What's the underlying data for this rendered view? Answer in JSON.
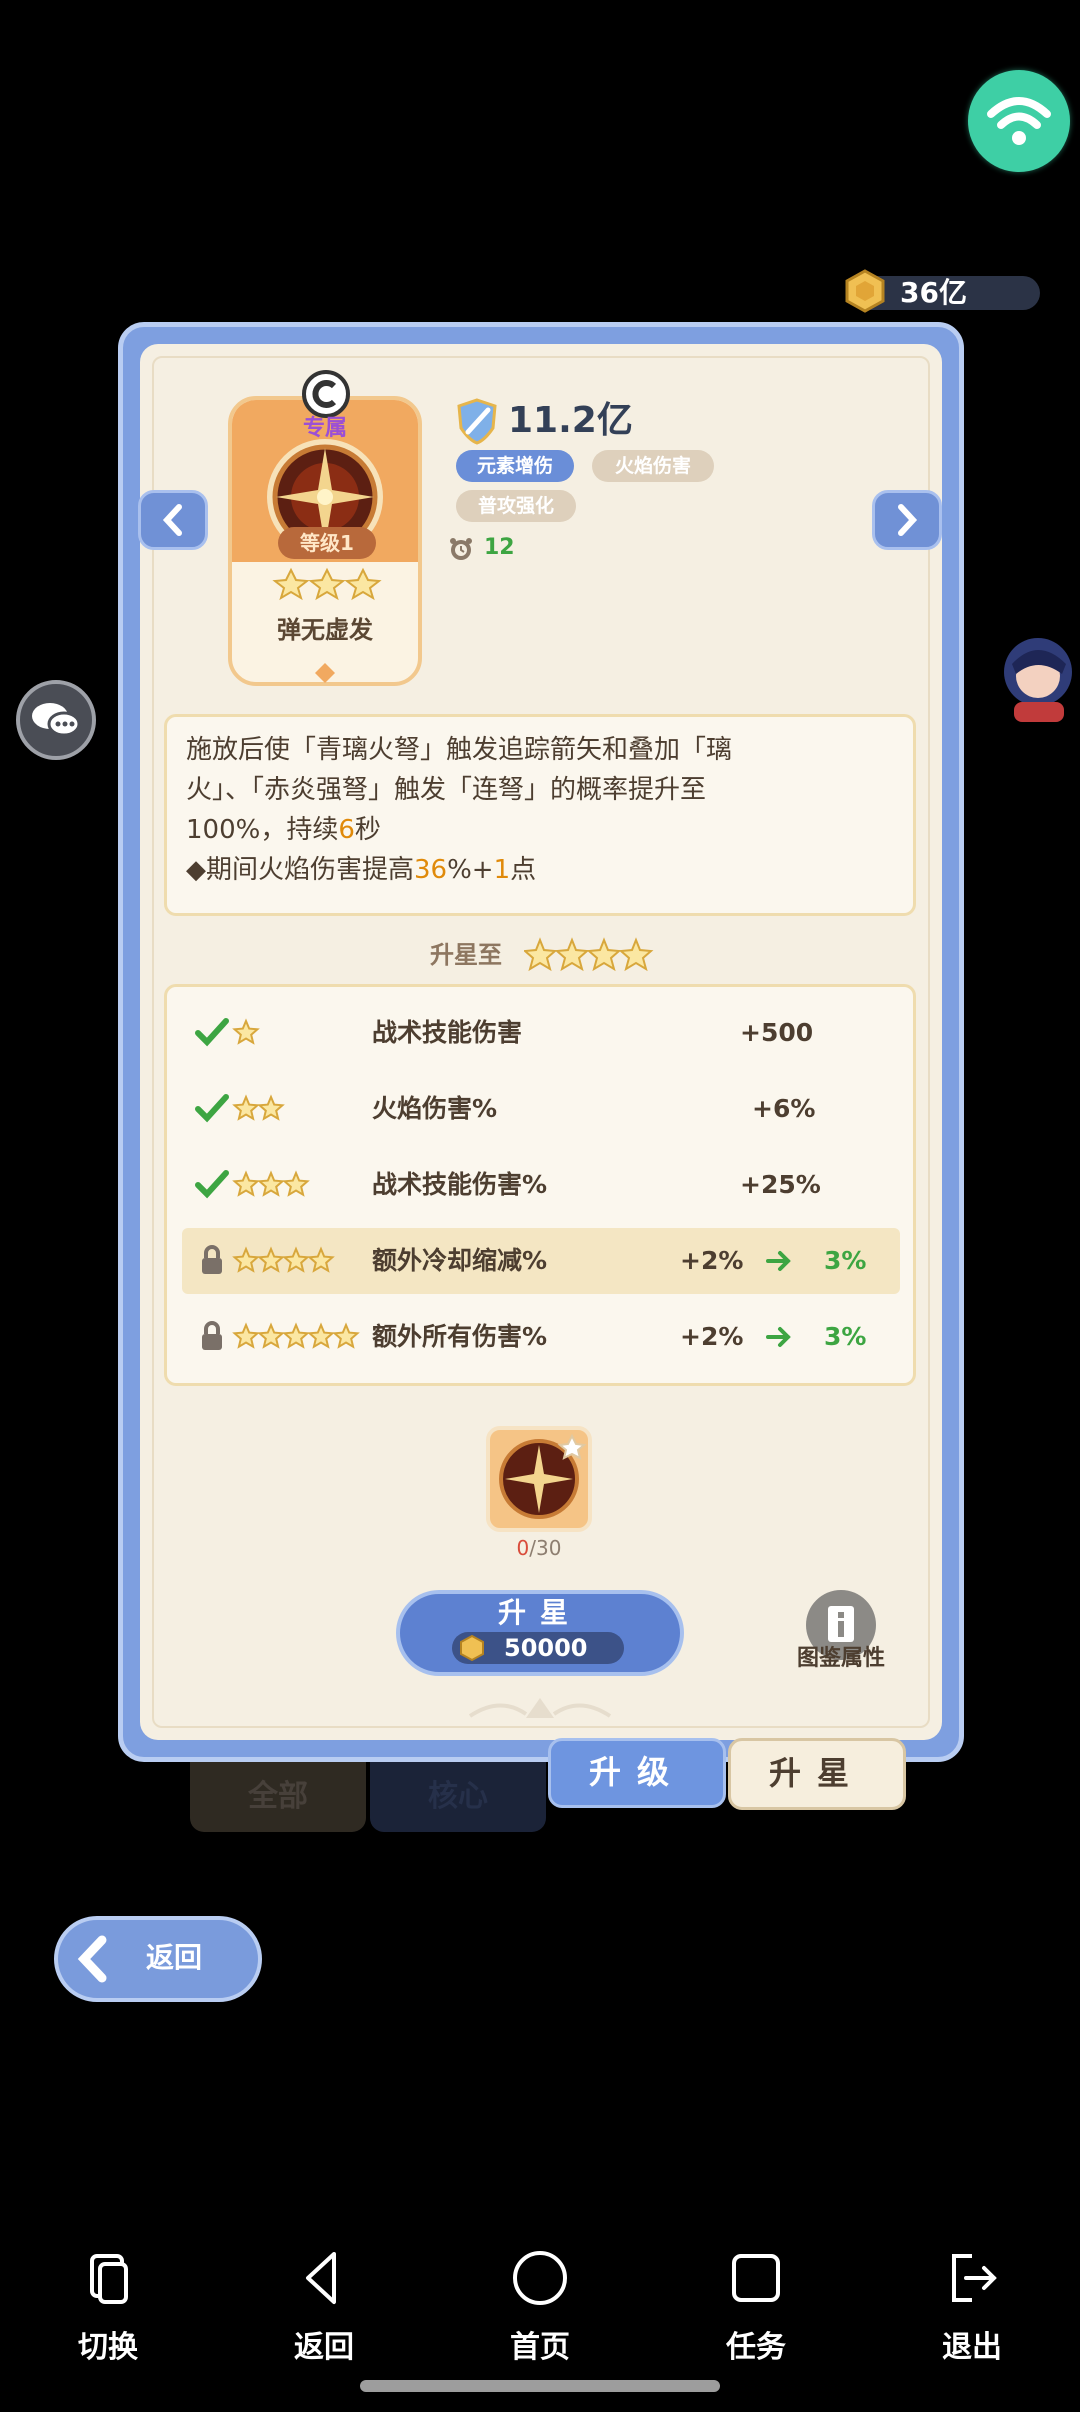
{
  "top": {
    "currency_amount": "36亿"
  },
  "card": {
    "tag": "专属",
    "level": "等级1",
    "name": "弹无虚发"
  },
  "power": "11.2亿",
  "tags": [
    "元素增伤",
    "火焰伤害",
    "普攻强化"
  ],
  "cooldown": "12",
  "description": {
    "line1": "施放后使「青璃火弩」触发追踪箭矢和叠加「璃",
    "line2": "火」、「赤炎强弩」触发「连弩」的概率提升至",
    "line3_a": "100%，持续",
    "line3_hl": "6",
    "line3_b": "秒",
    "line4_a": "◆期间火焰伤害提高",
    "line4_hl1": "36",
    "line4_b": "%+",
    "line4_hl2": "1",
    "line4_c": "点"
  },
  "upgrade_to_label": "升星至",
  "bonuses": [
    {
      "stars": 1,
      "unlocked": true,
      "name": "战术技能伤害",
      "value": "+500",
      "next": ""
    },
    {
      "stars": 2,
      "unlocked": true,
      "name": "火焰伤害%",
      "value": "+6%",
      "next": ""
    },
    {
      "stars": 3,
      "unlocked": true,
      "name": "战术技能伤害%",
      "value": "+25%",
      "next": ""
    },
    {
      "stars": 4,
      "unlocked": false,
      "name": "额外冷却缩减%",
      "value": "+2%",
      "next": "3%"
    },
    {
      "stars": 5,
      "unlocked": false,
      "name": "额外所有伤害%",
      "value": "+2%",
      "next": "3%"
    }
  ],
  "material": {
    "have": "0",
    "need": "/30"
  },
  "star_button": {
    "label": "升星",
    "cost": "50000"
  },
  "codex_label": "图鉴属性",
  "tabs": {
    "all": "全部",
    "core": "核心",
    "upgrade": "升级",
    "star": "升星"
  },
  "back_label": "返回",
  "system_nav": [
    {
      "icon": "switch-icon",
      "label": "切换"
    },
    {
      "icon": "back-icon",
      "label": "返回"
    },
    {
      "icon": "home-icon",
      "label": "首页"
    },
    {
      "icon": "task-icon",
      "label": "任务"
    },
    {
      "icon": "exit-icon",
      "label": "退出"
    }
  ],
  "colors": {
    "accent_blue": "#7e9fe0",
    "highlight": "#e08a0a",
    "green": "#3da542",
    "wifi": "#3ecfa5"
  }
}
